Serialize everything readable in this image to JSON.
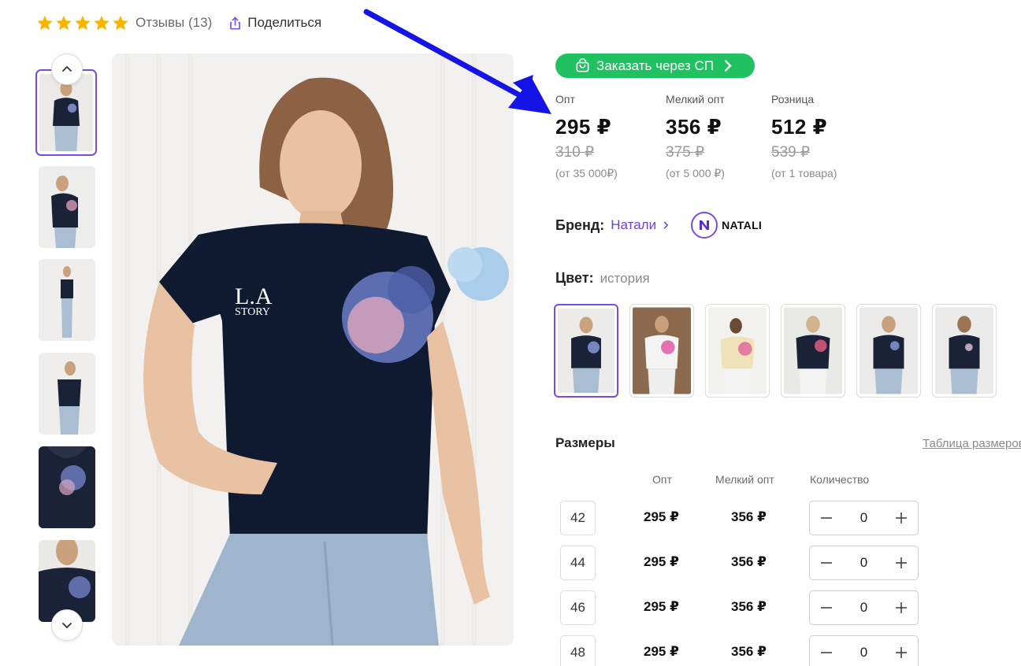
{
  "header": {
    "rating_stars": 5,
    "reviews_label": "Отзывы (13)",
    "share_label": "Поделиться"
  },
  "order": {
    "button_label": "Заказать через СП"
  },
  "prices": [
    {
      "label": "Опт",
      "price": "295 ₽",
      "old_price": "310 ₽",
      "condition": "(от 35 000₽)"
    },
    {
      "label": "Мелкий опт",
      "price": "356 ₽",
      "old_price": "375 ₽",
      "condition": "(от 5 000 ₽)"
    },
    {
      "label": "Розница",
      "price": "512 ₽",
      "old_price": "539 ₽",
      "condition": "(от 1 товара)"
    }
  ],
  "brand": {
    "label": "Бренд:",
    "name": "Натали",
    "logo_text": "NATALI"
  },
  "color": {
    "label": "Цвет:",
    "value": "история"
  },
  "sizes": {
    "title": "Размеры",
    "table_link": "Таблица размеров",
    "headers": {
      "opt": "Опт",
      "small_opt": "Мелкий опт",
      "quantity": "Количество"
    },
    "rows": [
      {
        "size": "42",
        "opt": "295 ₽",
        "small_opt": "356 ₽",
        "qty": "0"
      },
      {
        "size": "44",
        "opt": "295 ₽",
        "small_opt": "356 ₽",
        "qty": "0"
      },
      {
        "size": "46",
        "opt": "295 ₽",
        "small_opt": "356 ₽",
        "qty": "0"
      },
      {
        "size": "48",
        "opt": "295 ₽",
        "small_opt": "356 ₽",
        "qty": "0"
      }
    ]
  },
  "colors": {
    "accent": "#7b4ae2",
    "order_green": "#1fc160",
    "star": "#f7b500",
    "arrow": "#1414e6"
  },
  "icons": {
    "star": "star-icon",
    "share": "share-icon",
    "cart": "shopping-bag-icon",
    "chevron_right": "chevron-right-icon",
    "chevron_up": "chevron-up-icon",
    "chevron_down": "chevron-down-icon",
    "minus": "minus-icon",
    "plus": "plus-icon"
  }
}
